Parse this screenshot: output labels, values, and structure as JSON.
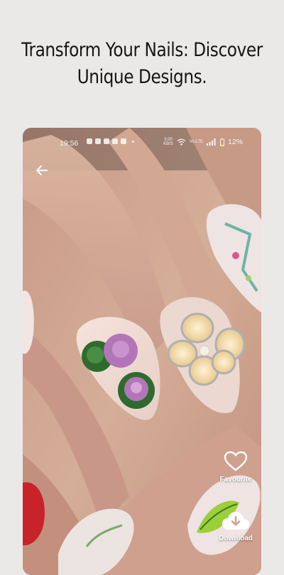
{
  "headline": {
    "line1": "Transform Your Nails: Discover",
    "line2": "Unique Designs."
  },
  "status_bar": {
    "time": "19:56",
    "speed_value": "3.00",
    "speed_unit": "KB/S",
    "network": "Vo LTE",
    "battery": "12%"
  },
  "actions": {
    "favourite_label": "Favourite",
    "download_label": "Download"
  },
  "icons": {
    "back": "arrow-left-icon",
    "favourite": "heart-icon",
    "download": "cloud-download-icon"
  },
  "colors": {
    "background": "#ebe9e8",
    "headline_text": "#151515",
    "overlay_text": "#ffffff"
  }
}
